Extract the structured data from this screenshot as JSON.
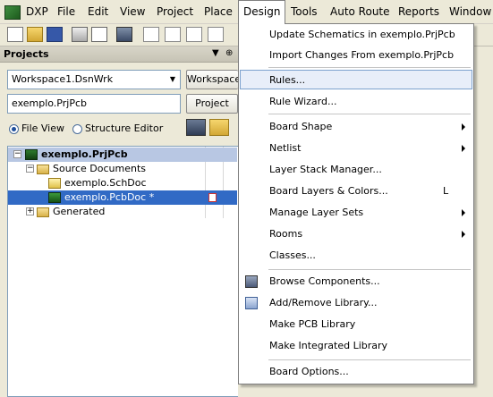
{
  "menubar": {
    "items": [
      "DXP",
      "File",
      "Edit",
      "View",
      "Project",
      "Place",
      "Design",
      "Tools",
      "Auto Route",
      "Reports",
      "Window"
    ],
    "active": "Design"
  },
  "toolbar": {
    "buttons": [
      "new-file-icon",
      "open-folder-icon",
      "save-icon",
      "print-icon",
      "print-preview-icon",
      "component-icon",
      "zoom-icon",
      "zoom-fit-icon",
      "cross-probe-icon",
      "browse-icon"
    ]
  },
  "projects_panel": {
    "title": "Projects",
    "workspace_value": "Workspace1.DsnWrk",
    "workspace_button": "Workspace",
    "project_value": "exemplo.PrjPcb",
    "project_button": "Project",
    "view_file": "File View",
    "view_structure": "Structure Editor",
    "tree": {
      "project": "exemplo.PrjPcb",
      "folder_source": "Source Documents",
      "doc_sch": "exemplo.SchDoc",
      "doc_pcb": "exemplo.PcbDoc *",
      "folder_generated": "Generated"
    }
  },
  "design_menu": {
    "items": [
      {
        "label": "Update Schematics in exemplo.PrjPcb",
        "submenu": false
      },
      {
        "label": "Import Changes From exemplo.PrjPcb",
        "submenu": false
      },
      {
        "label": "Rules...",
        "submenu": false,
        "highlighted": true
      },
      {
        "label": "Rule Wizard...",
        "submenu": false
      },
      {
        "label": "Board Shape",
        "submenu": true
      },
      {
        "label": "Netlist",
        "submenu": true
      },
      {
        "label": "Layer Stack Manager...",
        "submenu": false
      },
      {
        "label": "Board Layers & Colors...",
        "submenu": false,
        "shortcut": "L"
      },
      {
        "label": "Manage Layer Sets",
        "submenu": true
      },
      {
        "label": "Rooms",
        "submenu": true
      },
      {
        "label": "Classes...",
        "submenu": false
      },
      {
        "label": "Browse Components...",
        "submenu": false,
        "icon": "browse-components-icon"
      },
      {
        "label": "Add/Remove Library...",
        "submenu": false,
        "icon": "library-book-icon"
      },
      {
        "label": "Make PCB Library",
        "submenu": false
      },
      {
        "label": "Make Integrated Library",
        "submenu": false
      },
      {
        "label": "Board Options...",
        "submenu": false
      }
    ]
  },
  "colors": {
    "menu_highlight": "#e8eef9",
    "selection": "#316ac5",
    "panel_bg": "#ece9d8"
  }
}
